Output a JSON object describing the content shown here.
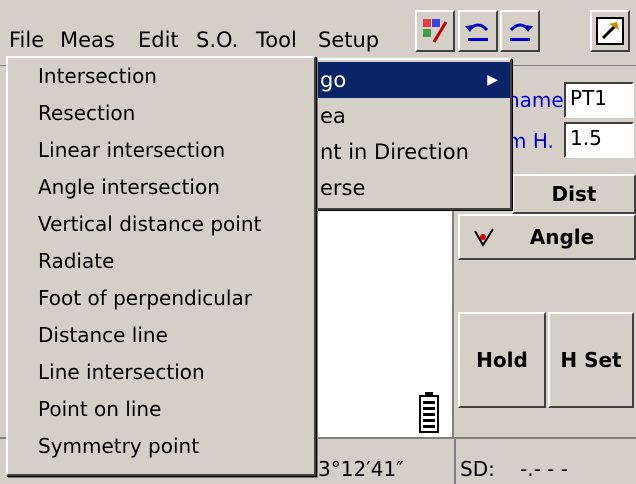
{
  "menubar": {
    "items": [
      "File",
      "Meas",
      "Edit",
      "S.O.",
      "Tool",
      "Setup"
    ]
  },
  "dropdown": {
    "items": [
      "Intersection",
      "Resection",
      "Linear intersection",
      "Angle intersection",
      "Vertical distance point",
      "Radiate",
      "Foot of perpendicular",
      "Distance line",
      "Line intersection",
      "Point on line",
      "Symmetry point"
    ]
  },
  "submenu": {
    "items": [
      "go",
      "ea",
      "nt in Direction",
      "erse"
    ],
    "highlighted_index": 0
  },
  "panel": {
    "name_label": "name",
    "name_value": "PT1",
    "height_label": "m H.",
    "height_value": "1.5",
    "dist_label": "Dist",
    "angle_label": "Angle",
    "hold_label": "Hold",
    "hset_label": "H Set"
  },
  "status": {
    "angle": "3°12′41″",
    "sd_label": "SD:",
    "sd_value": "-.- - -"
  },
  "colors": {
    "highlight": "#0a246a",
    "field_label": "#0000c8",
    "face": "#d4d0c8"
  }
}
